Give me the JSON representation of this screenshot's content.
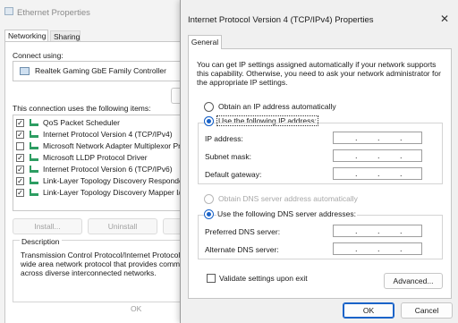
{
  "background_window": {
    "title": "Ethernet Properties",
    "tabs": [
      {
        "label": "Networking",
        "active": true
      },
      {
        "label": "Sharing",
        "active": false
      }
    ],
    "connect_using_label": "Connect using:",
    "adapter_name": "Realtek Gaming GbE Family Controller",
    "items_label": "This connection uses the following items:",
    "items": [
      {
        "label": "QoS Packet Scheduler",
        "checked": true,
        "icon": "qos-scheduler-icon"
      },
      {
        "label": "Internet Protocol Version 4 (TCP/IPv4)",
        "checked": true,
        "icon": "protocol-icon"
      },
      {
        "label": "Microsoft Network Adapter Multiplexor Prot",
        "checked": false,
        "icon": "protocol-icon"
      },
      {
        "label": "Microsoft LLDP Protocol Driver",
        "checked": true,
        "icon": "protocol-icon"
      },
      {
        "label": "Internet Protocol Version 6 (TCP/IPv6)",
        "checked": true,
        "icon": "protocol-icon"
      },
      {
        "label": "Link-Layer Topology Discovery Responder",
        "checked": true,
        "icon": "protocol-icon"
      },
      {
        "label": "Link-Layer Topology Discovery Mapper I/O",
        "checked": true,
        "icon": "protocol-icon"
      }
    ],
    "install_label": "Install...",
    "uninstall_label": "Uninstall",
    "description_title": "Description",
    "description_lines": [
      "Transmission Control Protocol/Internet Protocol. T",
      "wide area network protocol that provides commun",
      "across diverse interconnected networks."
    ],
    "ok_label": "OK"
  },
  "dialog": {
    "title": "Internet Protocol Version 4 (TCP/IPv4) Properties",
    "close_glyph": "✕",
    "tab_label": "General",
    "intro_text": "You can get IP settings assigned automatically if your network supports this capability. Otherwise, you need to ask your network administrator for the appropriate IP settings.",
    "ip_auto_label": "Obtain an IP address automatically",
    "ip_manual_label": "Use the following IP address:",
    "ip_mode": "manual",
    "ip_fields": [
      {
        "label": "IP address:",
        "value": ""
      },
      {
        "label": "Subnet mask:",
        "value": ""
      },
      {
        "label": "Default gateway:",
        "value": ""
      }
    ],
    "dns_auto_label": "Obtain DNS server address automatically",
    "dns_manual_label": "Use the following DNS server addresses:",
    "dns_mode": "manual",
    "dns_fields": [
      {
        "label": "Preferred DNS server:",
        "value": ""
      },
      {
        "label": "Alternate DNS server:",
        "value": ""
      }
    ],
    "validate_label": "Validate settings upon exit",
    "validate_checked": false,
    "advanced_label": "Advanced...",
    "ok_label": "OK",
    "cancel_label": "Cancel",
    "ip_separator": "."
  },
  "colors": {
    "accent": "#1a63c8",
    "disabled_text": "#a8a8a8"
  }
}
